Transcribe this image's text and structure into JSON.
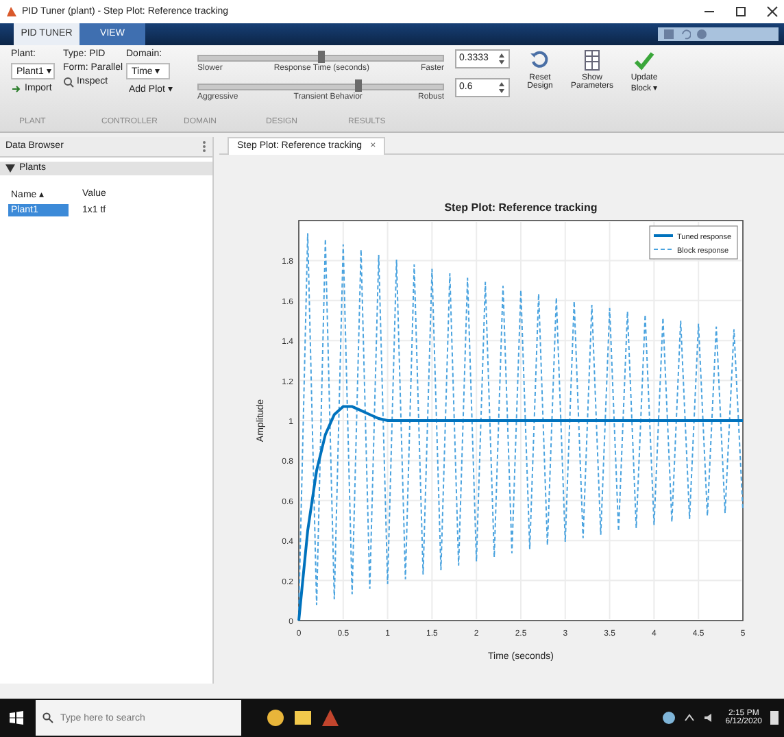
{
  "window": {
    "title": "PID Tuner (plant) - Step Plot: Reference tracking"
  },
  "tabs": [
    {
      "label": "PID TUNER",
      "selected": true
    },
    {
      "label": "VIEW",
      "selected": false
    }
  ],
  "toolstrip": {
    "plant_label": "Plant:",
    "plant_value": "Plant1 ▾",
    "type_label": "Type: PID",
    "form_label": "Form: Parallel",
    "domain_label": "Domain:",
    "domain_value": "Time ▾",
    "import": "Import",
    "inspect": "Inspect",
    "add_plot": "Add Plot ▾",
    "sliders": [
      {
        "left": "Slower",
        "caption": "Response Time (seconds)",
        "right": "Faster",
        "level": 0.5,
        "value": "0.3333"
      },
      {
        "left": "Aggressive",
        "caption": "Transient Behavior",
        "right": "Robust",
        "level": 0.65,
        "value": "0.6"
      }
    ],
    "buttons": [
      "Reset Design",
      "Show Parameters",
      "Update Block ▾"
    ],
    "sections": [
      "PLANT",
      "CONTROLLER",
      "DOMAIN",
      "DESIGN",
      "RESULTS"
    ]
  },
  "data_browser": {
    "title": "Data Browser",
    "section": "Plants",
    "columns": [
      "Name ▴",
      "Value"
    ],
    "rows": [
      {
        "name": "Plant1",
        "value": "1x1 tf",
        "selected": true
      }
    ]
  },
  "document_tab": {
    "label": "Step Plot: Reference tracking",
    "close": "×"
  },
  "plot": {
    "chart_data": {
      "type": "line",
      "title": "Step Plot: Reference tracking",
      "xlabel": "Time (seconds)",
      "ylabel": "Amplitude",
      "xlim": [
        0,
        5
      ],
      "ylim": [
        0,
        2
      ],
      "grid": true,
      "legend": true,
      "xticks": [
        0,
        0.5,
        1,
        1.5,
        2,
        2.5,
        3,
        3.5,
        4,
        4.5,
        5
      ],
      "yticks": [
        0,
        0.2,
        0.4,
        0.6,
        0.8,
        1,
        1.2,
        1.4,
        1.6,
        1.8
      ],
      "x": [
        0,
        0.1,
        0.2,
        0.3,
        0.4,
        0.5,
        0.6,
        0.7,
        0.8,
        0.9,
        1,
        1.1,
        1.2,
        1.3,
        1.4,
        1.5,
        1.6,
        1.7,
        1.8,
        1.9,
        2,
        2.1,
        2.2,
        2.3,
        2.4,
        2.5,
        2.6,
        2.7,
        2.8,
        2.9,
        3,
        3.1,
        3.2,
        3.3,
        3.4,
        3.5,
        3.6,
        3.7,
        3.8,
        3.9,
        4,
        4.1,
        4.2,
        4.3,
        4.4,
        4.5,
        4.6,
        4.7,
        4.8,
        4.9,
        5
      ],
      "series": [
        {
          "name": "Tuned response",
          "color": "#0072bd",
          "line_style": "solid",
          "values": [
            0,
            0.45,
            0.75,
            0.93,
            1.03,
            1.07,
            1.07,
            1.05,
            1.03,
            1.01,
            1,
            1,
            1,
            1,
            1,
            1,
            1,
            1,
            1,
            1,
            1,
            1,
            1,
            1,
            1,
            1,
            1,
            1,
            1,
            1,
            1,
            1,
            1,
            1,
            1,
            1,
            1,
            1,
            1,
            1,
            1,
            1,
            1,
            1,
            1,
            1,
            1,
            1,
            1,
            1,
            1
          ]
        },
        {
          "name": "Block response",
          "color": "#4aa3df",
          "line_style": "dashed",
          "values": [
            0.05,
            1.936,
            0.078,
            1.908,
            0.106,
            1.881,
            0.132,
            1.855,
            0.158,
            1.829,
            0.182,
            1.805,
            0.207,
            1.781,
            0.23,
            1.758,
            0.253,
            1.736,
            0.275,
            1.714,
            0.296,
            1.693,
            0.317,
            1.673,
            0.337,
            1.653,
            0.357,
            1.634,
            0.376,
            1.615,
            0.394,
            1.597,
            0.412,
            1.579,
            0.429,
            1.562,
            0.446,
            1.546,
            0.462,
            1.53,
            0.478,
            1.514,
            0.493,
            1.499,
            0.508,
            1.484,
            0.523,
            1.47,
            0.537,
            1.456,
            0.551
          ]
        }
      ]
    }
  },
  "taskbar": {
    "search_placeholder": "Type here to search",
    "time": "2:15 PM",
    "date": "6/12/2020"
  }
}
